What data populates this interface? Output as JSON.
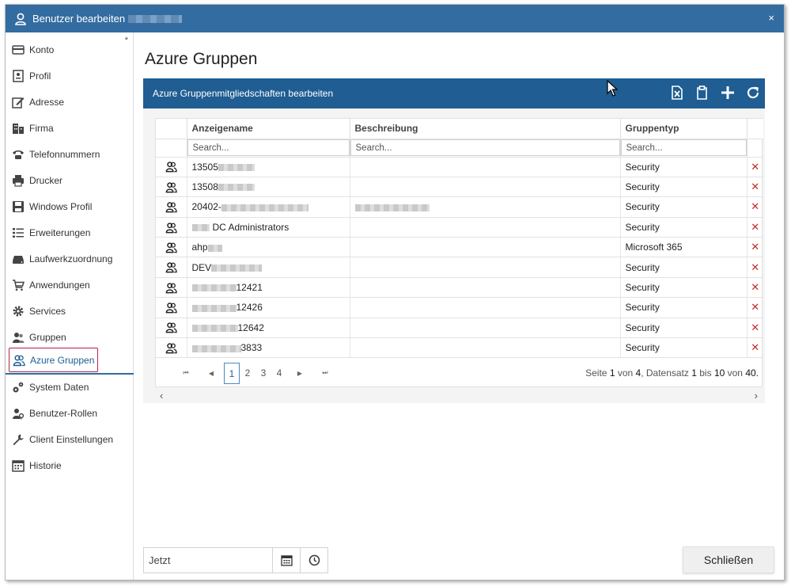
{
  "window": {
    "title": "Benutzer bearbeiten",
    "title_color": "#336ca1",
    "close_icon": "×"
  },
  "sidebar": {
    "asterisk": "*",
    "items": [
      {
        "label": "Konto",
        "icon": "card-icon"
      },
      {
        "label": "Profil",
        "icon": "profile-icon"
      },
      {
        "label": "Adresse",
        "icon": "edit-icon"
      },
      {
        "label": "Firma",
        "icon": "building-icon"
      },
      {
        "label": "Telefonnummern",
        "icon": "phone-icon"
      },
      {
        "label": "Drucker",
        "icon": "printer-icon"
      },
      {
        "label": "Windows Profil",
        "icon": "save-icon"
      },
      {
        "label": "Erweiterungen",
        "icon": "list-icon"
      },
      {
        "label": "Laufwerkzuordnung",
        "icon": "drive-icon"
      },
      {
        "label": "Anwendungen",
        "icon": "cart-icon"
      },
      {
        "label": "Services",
        "icon": "gear-icon"
      },
      {
        "label": "Gruppen",
        "icon": "group-icon"
      },
      {
        "label": "Azure Gruppen",
        "icon": "azure-group-icon",
        "active": true
      },
      {
        "label": "System Daten",
        "icon": "system-icon"
      },
      {
        "label": "Benutzer-Rollen",
        "icon": "user-role-icon"
      },
      {
        "label": "Client Einstellungen",
        "icon": "wrench-icon"
      },
      {
        "label": "Historie",
        "icon": "history-icon"
      }
    ],
    "active_color": "#b0234a"
  },
  "main": {
    "title": "Azure Gruppen",
    "panel": {
      "header": "Azure Gruppenmitgliedschaften bearbeiten",
      "header_color": "#1f5d92",
      "tools": [
        "excel-export-icon",
        "clipboard-icon",
        "plus-icon",
        "refresh-icon"
      ]
    },
    "grid": {
      "columns": [
        "Anzeigename",
        "Beschreibung",
        "Gruppentyp"
      ],
      "search_placeholder": "Search...",
      "rows": [
        {
          "name": "13505",
          "desc": "",
          "type": "Security"
        },
        {
          "name": "13508",
          "desc": "",
          "type": "Security"
        },
        {
          "name": "20402-",
          "desc": "",
          "type": "Security"
        },
        {
          "name": "DC Administrators",
          "desc": "",
          "type": "Security"
        },
        {
          "name": "ahp",
          "desc": "",
          "type": "Microsoft 365"
        },
        {
          "name": "DEV",
          "desc": "",
          "type": "Security"
        },
        {
          "name": "12421",
          "desc": "",
          "type": "Security"
        },
        {
          "name": "12426",
          "desc": "",
          "type": "Security"
        },
        {
          "name": "12642",
          "desc": "",
          "type": "Security"
        },
        {
          "name": "3833",
          "desc": "",
          "type": "Security"
        }
      ],
      "delete_icon": "✕",
      "delete_color": "#c62828"
    },
    "pager": {
      "pages": [
        "1",
        "2",
        "3",
        "4"
      ],
      "current": "1",
      "info_pre": "Seite ",
      "info_page": "1",
      "info_of": " von ",
      "info_pages": "4",
      "info_rec": ", Datensatz ",
      "info_from": "1",
      "info_bis": " bis ",
      "info_to": "10",
      "info_von": " von ",
      "info_total": "40."
    }
  },
  "footer": {
    "date_value": "Jetzt",
    "close_label": "Schließen"
  }
}
